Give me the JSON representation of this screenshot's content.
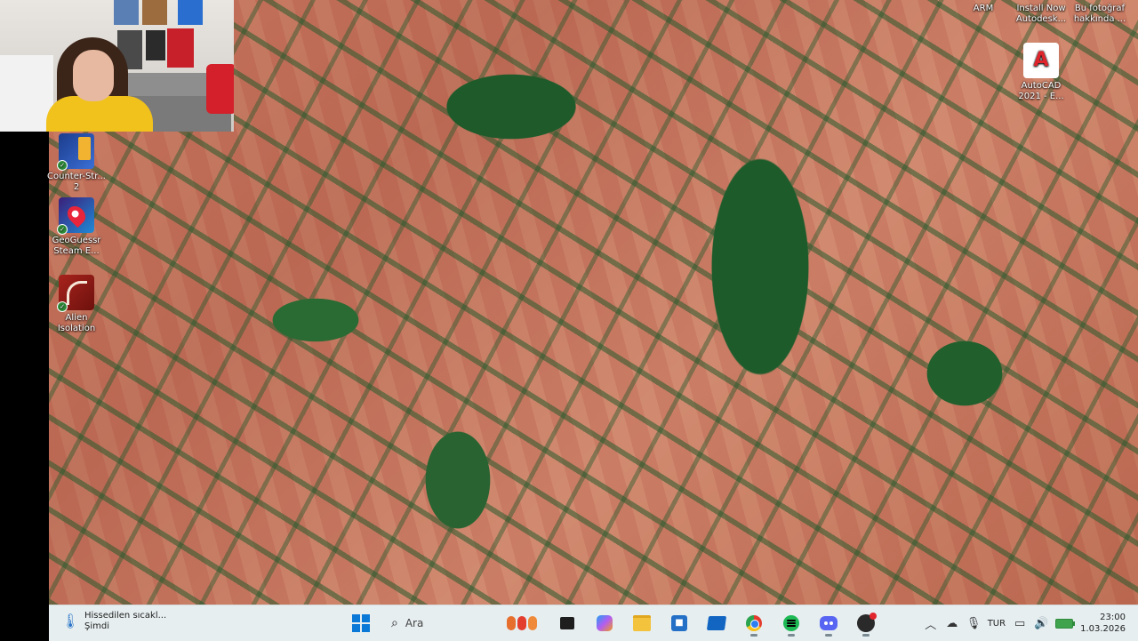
{
  "desktop": {
    "icons": [
      {
        "label_line1": "Counter-Str...",
        "label_line2": "2"
      },
      {
        "label_line1": "GeoGuessr",
        "label_line2": "Steam E..."
      },
      {
        "label_line1": "Alien",
        "label_line2": "Isolation"
      },
      {
        "label_line1": "AutoCAD",
        "label_line2": "2021 - E..."
      }
    ],
    "autocad_glyph": "A",
    "top_labels": {
      "arm": "ARM",
      "install_line1": "Install Now",
      "install_line2": "Autodesk...",
      "photo_line1": "Bu fotoğraf",
      "photo_line2": "hakkında ..."
    }
  },
  "taskbar": {
    "weather": {
      "line1": "Hissedilen sıcakl...",
      "line2": "Şimdi"
    },
    "search": {
      "placeholder": "Ara"
    },
    "store_glyph": "■",
    "tray": {
      "language": "TUR",
      "time": "23:00",
      "date": "1.03.2026"
    }
  },
  "colors": {
    "taskbar_bg": "#e6eef0",
    "windows_blue": "#0a78d7",
    "field_red": "#c97a62",
    "forest_green": "#1f5a2a"
  }
}
